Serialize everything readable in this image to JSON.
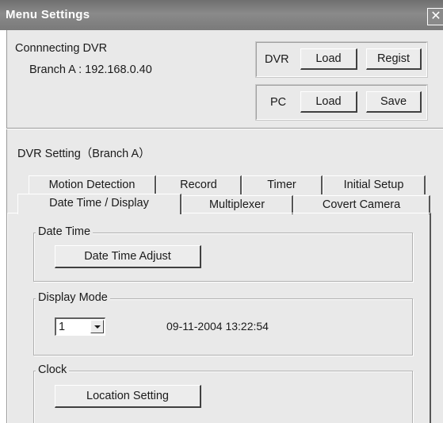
{
  "window": {
    "title": "Menu Settings",
    "close_glyph": "✕"
  },
  "connection": {
    "label": "Connnecting DVR",
    "branch": "Branch A : 192.168.0.40"
  },
  "dvr_box": {
    "label": "DVR",
    "load": "Load",
    "regist": "Regist"
  },
  "pc_box": {
    "label": "PC",
    "load": "Load",
    "save": "Save"
  },
  "section_title": "DVR Setting（Branch A）",
  "tabs_back": [
    "Motion Detection",
    "Record",
    "Timer",
    "Initial Setup"
  ],
  "tabs_front": [
    "Date Time / Display",
    "Multiplexer",
    "Covert Camera"
  ],
  "active_tab": "Date Time / Display",
  "date_time_group": {
    "legend": "Date Time",
    "button": "Date Time Adjust"
  },
  "display_mode_group": {
    "legend": "Display Mode",
    "selected": "1",
    "datetime": "09-11-2004 13:22:54"
  },
  "clock_group": {
    "legend": "Clock",
    "button": "Location Setting"
  },
  "icons": {
    "close": "close-icon",
    "dropdown": "chevron-down-icon"
  }
}
